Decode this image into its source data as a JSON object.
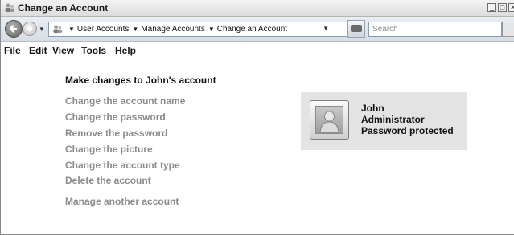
{
  "window": {
    "title": "Change an Account",
    "icon": "user-accounts-icon",
    "controls": [
      "_",
      "□",
      "×"
    ]
  },
  "navigation": {
    "back_icon": "back-arrow-icon",
    "forward_icon": "forward-arrow-icon",
    "breadcrumbs": [
      "User Accounts",
      "Manage Accounts",
      "Change an Account"
    ],
    "search_placeholder": "Search"
  },
  "menu": [
    "File",
    "Edit",
    "View",
    "Tools",
    "Help"
  ],
  "content": {
    "heading": "Make changes to John's account",
    "tasks": [
      "Change the account name",
      "Change the password",
      "Remove the password",
      "Change the picture",
      "Change the account type",
      "Delete the account"
    ],
    "other_link": "Manage another account"
  },
  "account": {
    "name": "John",
    "type": "Administrator",
    "status": "Password protected",
    "avatar_icon": "user-avatar-icon"
  },
  "colors": {
    "task_link": "#8c8c8c",
    "card_background": "#e3e3e3",
    "nav_bar": "#dfe4ea"
  }
}
